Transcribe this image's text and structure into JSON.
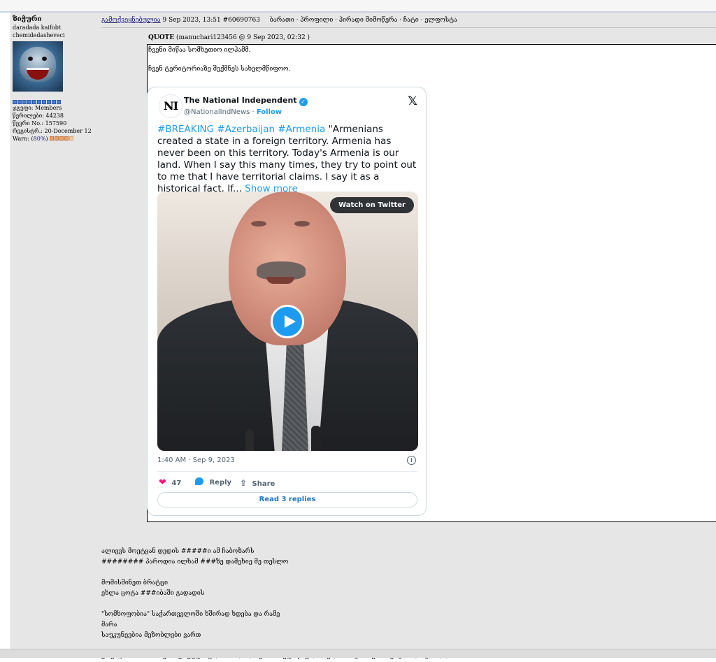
{
  "user": {
    "name": "ზიჭური",
    "title_line1": "daradada kaifobt",
    "title_line2": "chemidedasheveci",
    "avatar_icon": "shark-avatar",
    "group": "ჯგუფი: Members",
    "posts": "წერილები: 44238",
    "member_no": "წევრი No.: 157590",
    "registered": "რეგისტრ.: 20-December 12",
    "warn_prefix": "Warn: (",
    "warn_value": "80%",
    "warn_suffix": ")"
  },
  "post_header": {
    "posted_label": "გამოქვეყნებულია",
    "datetime": "9 Sep 2023, 13:51",
    "post_id": "#60690763",
    "links": "ბარათი · პროფილი · პირადი მიმოწერა · ჩატი · ელფოსტა"
  },
  "quote": {
    "label": "QUOTE",
    "meta": "(manuchari123456 @ 9 Sep 2023, 02:32 )",
    "line1": "ჩვენი მიწაა სომხეთიო ილჰამმ.",
    "line2": "ჩვენ ტერიტორიაზე შექმნეს სახელმწიფოო."
  },
  "tweet": {
    "logo": "NI",
    "name": "The National Independent",
    "handle": "@NationalIndNews",
    "dot": " · ",
    "follow": "Follow",
    "hashtags": "#BREAKING #Azerbaijan #Armenia",
    "text": " \"Armenians created a state in a foreign territory. Armenia has never been on this territory. Today's Armenia is our land. When I say this many times, they try to point out to me that I have territorial claims. I say it as a historical fact. If...",
    "show_more": "Show more",
    "watch": "Watch on Twitter",
    "timestamp": "1:40 AM · Sep 9, 2023",
    "likes": "47",
    "reply": "Reply",
    "share": "Share",
    "read_replies": "Read 3 replies",
    "colors": {
      "accent": "#1d9bf0",
      "like": "#f91880"
    }
  },
  "body": {
    "l1": "ალიევს მოეტყან დედის #####ი ამ ჩაბოზარს",
    "l2": "######## პაროდია ილხამ ###ზე დამეხიე მე თესლო",
    "l3": "მომისმინეთ ბრატცი",
    "l4": "ეხლა ცოტა ###იბაში გადადის",
    "l5": "\"სომხოფობია\" საქართველოში ხშირად ხდება და რამე",
    "l6": "მარა",
    "l7": "საუკუნეებია მეზობლები ვართ",
    "l8": "ეს ვიღ ჩიმი ###ა ეს თურქული ტომი? რო სომხებს სახელმწიფო არ ქონიათ და აზერია უნდა მოახდინოო?"
  }
}
